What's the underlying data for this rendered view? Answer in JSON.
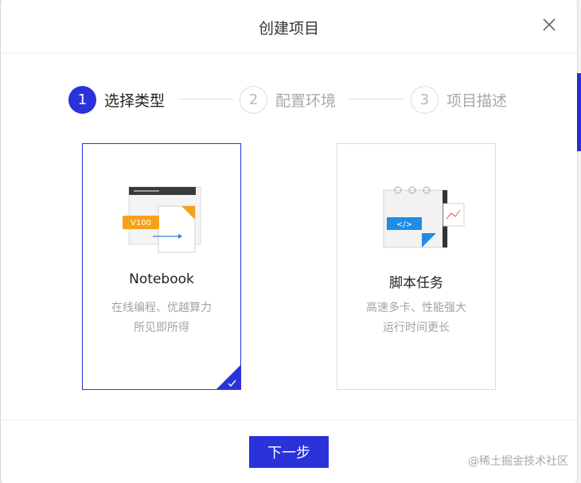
{
  "dialog": {
    "title": "创建项目"
  },
  "steps": [
    {
      "num": "1",
      "label": "选择类型",
      "state": "active"
    },
    {
      "num": "2",
      "label": "配置环境",
      "state": "todo"
    },
    {
      "num": "3",
      "label": "项目描述",
      "state": "todo"
    }
  ],
  "cards": [
    {
      "title": "Notebook",
      "desc1": "在线编程、优越算力",
      "desc2": "所见即所得",
      "selected": true,
      "badge": "V100"
    },
    {
      "title": "脚本任务",
      "desc1": "高速多卡、性能强大",
      "desc2": "运行时间更长",
      "selected": false,
      "badge": "</>"
    }
  ],
  "footer": {
    "next_label": "下一步"
  },
  "watermark": "@稀土掘金技术社区",
  "colors": {
    "accent": "#2a33d9",
    "orange": "#f5a11c",
    "blue_badge": "#1f8ce6"
  },
  "icons": {
    "close": "close-icon",
    "check": "check-icon"
  }
}
